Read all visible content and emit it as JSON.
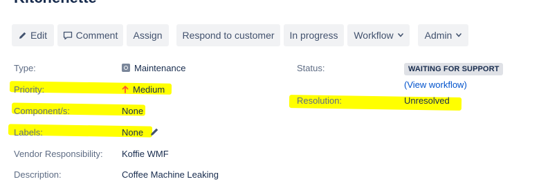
{
  "issue": {
    "title": "Kitchenette"
  },
  "toolbar": {
    "edit": "Edit",
    "comment": "Comment",
    "assign": "Assign",
    "respond": "Respond to customer",
    "in_progress": "In progress",
    "workflow": "Workflow",
    "admin": "Admin"
  },
  "details": {
    "type_label": "Type:",
    "type_value": "Maintenance",
    "priority_label": "Priority:",
    "priority_value": "Medium",
    "components_label": "Component/s:",
    "components_value": "None",
    "labels_label": "Labels:",
    "labels_value": "None",
    "vendor_label": "Vendor Responsibility:",
    "vendor_value": "Koffie WMF",
    "description_label": "Description:",
    "description_value": "Coffee Machine Leaking"
  },
  "status": {
    "status_label": "Status:",
    "status_value": "WAITING FOR SUPPORT",
    "view_workflow": "(View workflow)",
    "resolution_label": "Resolution:",
    "resolution_value": "Unresolved"
  },
  "colors": {
    "highlight": "#ffff00",
    "priority_arrow": "#ff5630",
    "link": "#0052cc",
    "button_bg": "#f1f2f4",
    "badge_bg": "#dfe1e6"
  },
  "icons": {
    "edit": "pencil-icon",
    "comment": "speech-bubble-icon",
    "type": "maintenance-type-icon",
    "priority": "arrow-up-icon",
    "labels_edit": "pencil-icon",
    "dropdown": "chevron-down-icon"
  }
}
